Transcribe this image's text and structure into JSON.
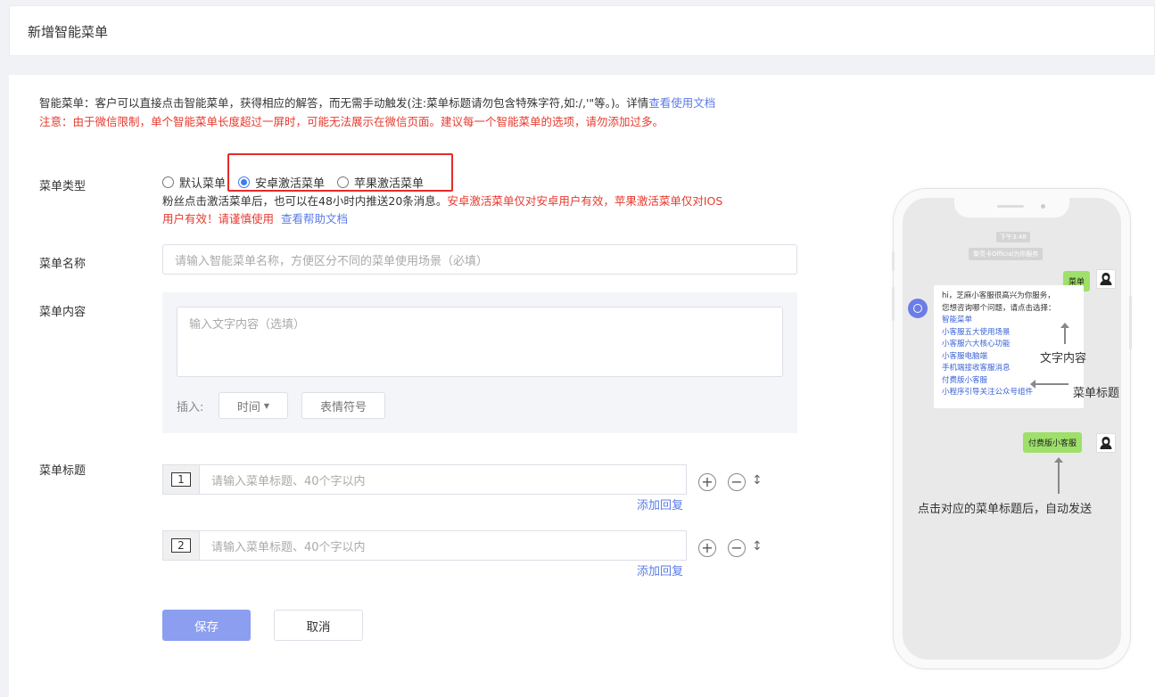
{
  "header": {
    "title": "新增智能菜单"
  },
  "notice": {
    "line1": "智能菜单：客户可以直接点击智能菜单，获得相应的解答，而无需手动触发(注:菜单标题请勿包含特殊字符,如:/,'\"等。)。详情",
    "line1_link": "查看使用文档",
    "line2": "注意：由于微信限制，单个智能菜单长度超过一屏时，可能无法展示在微信页面。建议每一个智能菜单的选项，请勿添加过多。"
  },
  "menu_type": {
    "label": "菜单类型",
    "options": [
      "默认菜单",
      "安卓激活菜单",
      "苹果激活菜单"
    ],
    "selected": "安卓激活菜单",
    "desc_black": "粉丝点击激活菜单后，也可以在48小时内推送20条消息。",
    "desc_red1": "安卓激活菜单仅对安卓用户有效，苹果激活菜单仅对IOS",
    "desc_red2": "用户有效！请谨慎使用",
    "desc_link": "查看帮助文档"
  },
  "menu_name": {
    "label": "菜单名称",
    "placeholder": "请输入智能菜单名称，方便区分不同的菜单使用场景（必填）"
  },
  "menu_content": {
    "label": "菜单内容",
    "placeholder": "输入文字内容（选填）",
    "insert_label": "插入:",
    "time_button": "时间",
    "emoji_button": "表情符号"
  },
  "menu_titles": {
    "label": "菜单标题",
    "items": [
      {
        "num": "1",
        "placeholder": "请输入菜单标题、40个字以内",
        "add_reply": "添加回复"
      },
      {
        "num": "2",
        "placeholder": "请输入菜单标题、40个字以内",
        "add_reply": "添加回复"
      }
    ],
    "add_icon": "+",
    "remove_icon": "−",
    "sort_icon": "↕"
  },
  "actions": {
    "save": "保存",
    "cancel": "取消"
  },
  "preview": {
    "time": "下午3:48",
    "system": "黎灵卡Official为你服务",
    "user_msg1": "菜单",
    "bot_greeting1": "hi，芝麻小客服很高兴为你服务，",
    "bot_greeting2": "您想咨询哪个问题，请点击选择：",
    "bot_links": [
      "智能菜单",
      "小客服五大使用场景",
      "小客服六大核心功能",
      "小客服电脑端",
      "手机端接收客服消息",
      "付费版小客服",
      "小程序引导关注公众号组件"
    ],
    "user_msg2": "付费版小客服",
    "anno_text_content": "文字内容",
    "anno_menu_title": "菜单标题",
    "anno_auto_send": "点击对应的菜单标题后，自动发送"
  },
  "colors": {
    "primary": "#8b9ef0",
    "link": "#5b7be8",
    "warning": "#e63a2e",
    "highlight_box": "#e52a2a",
    "chat_green": "#9ee06a"
  }
}
